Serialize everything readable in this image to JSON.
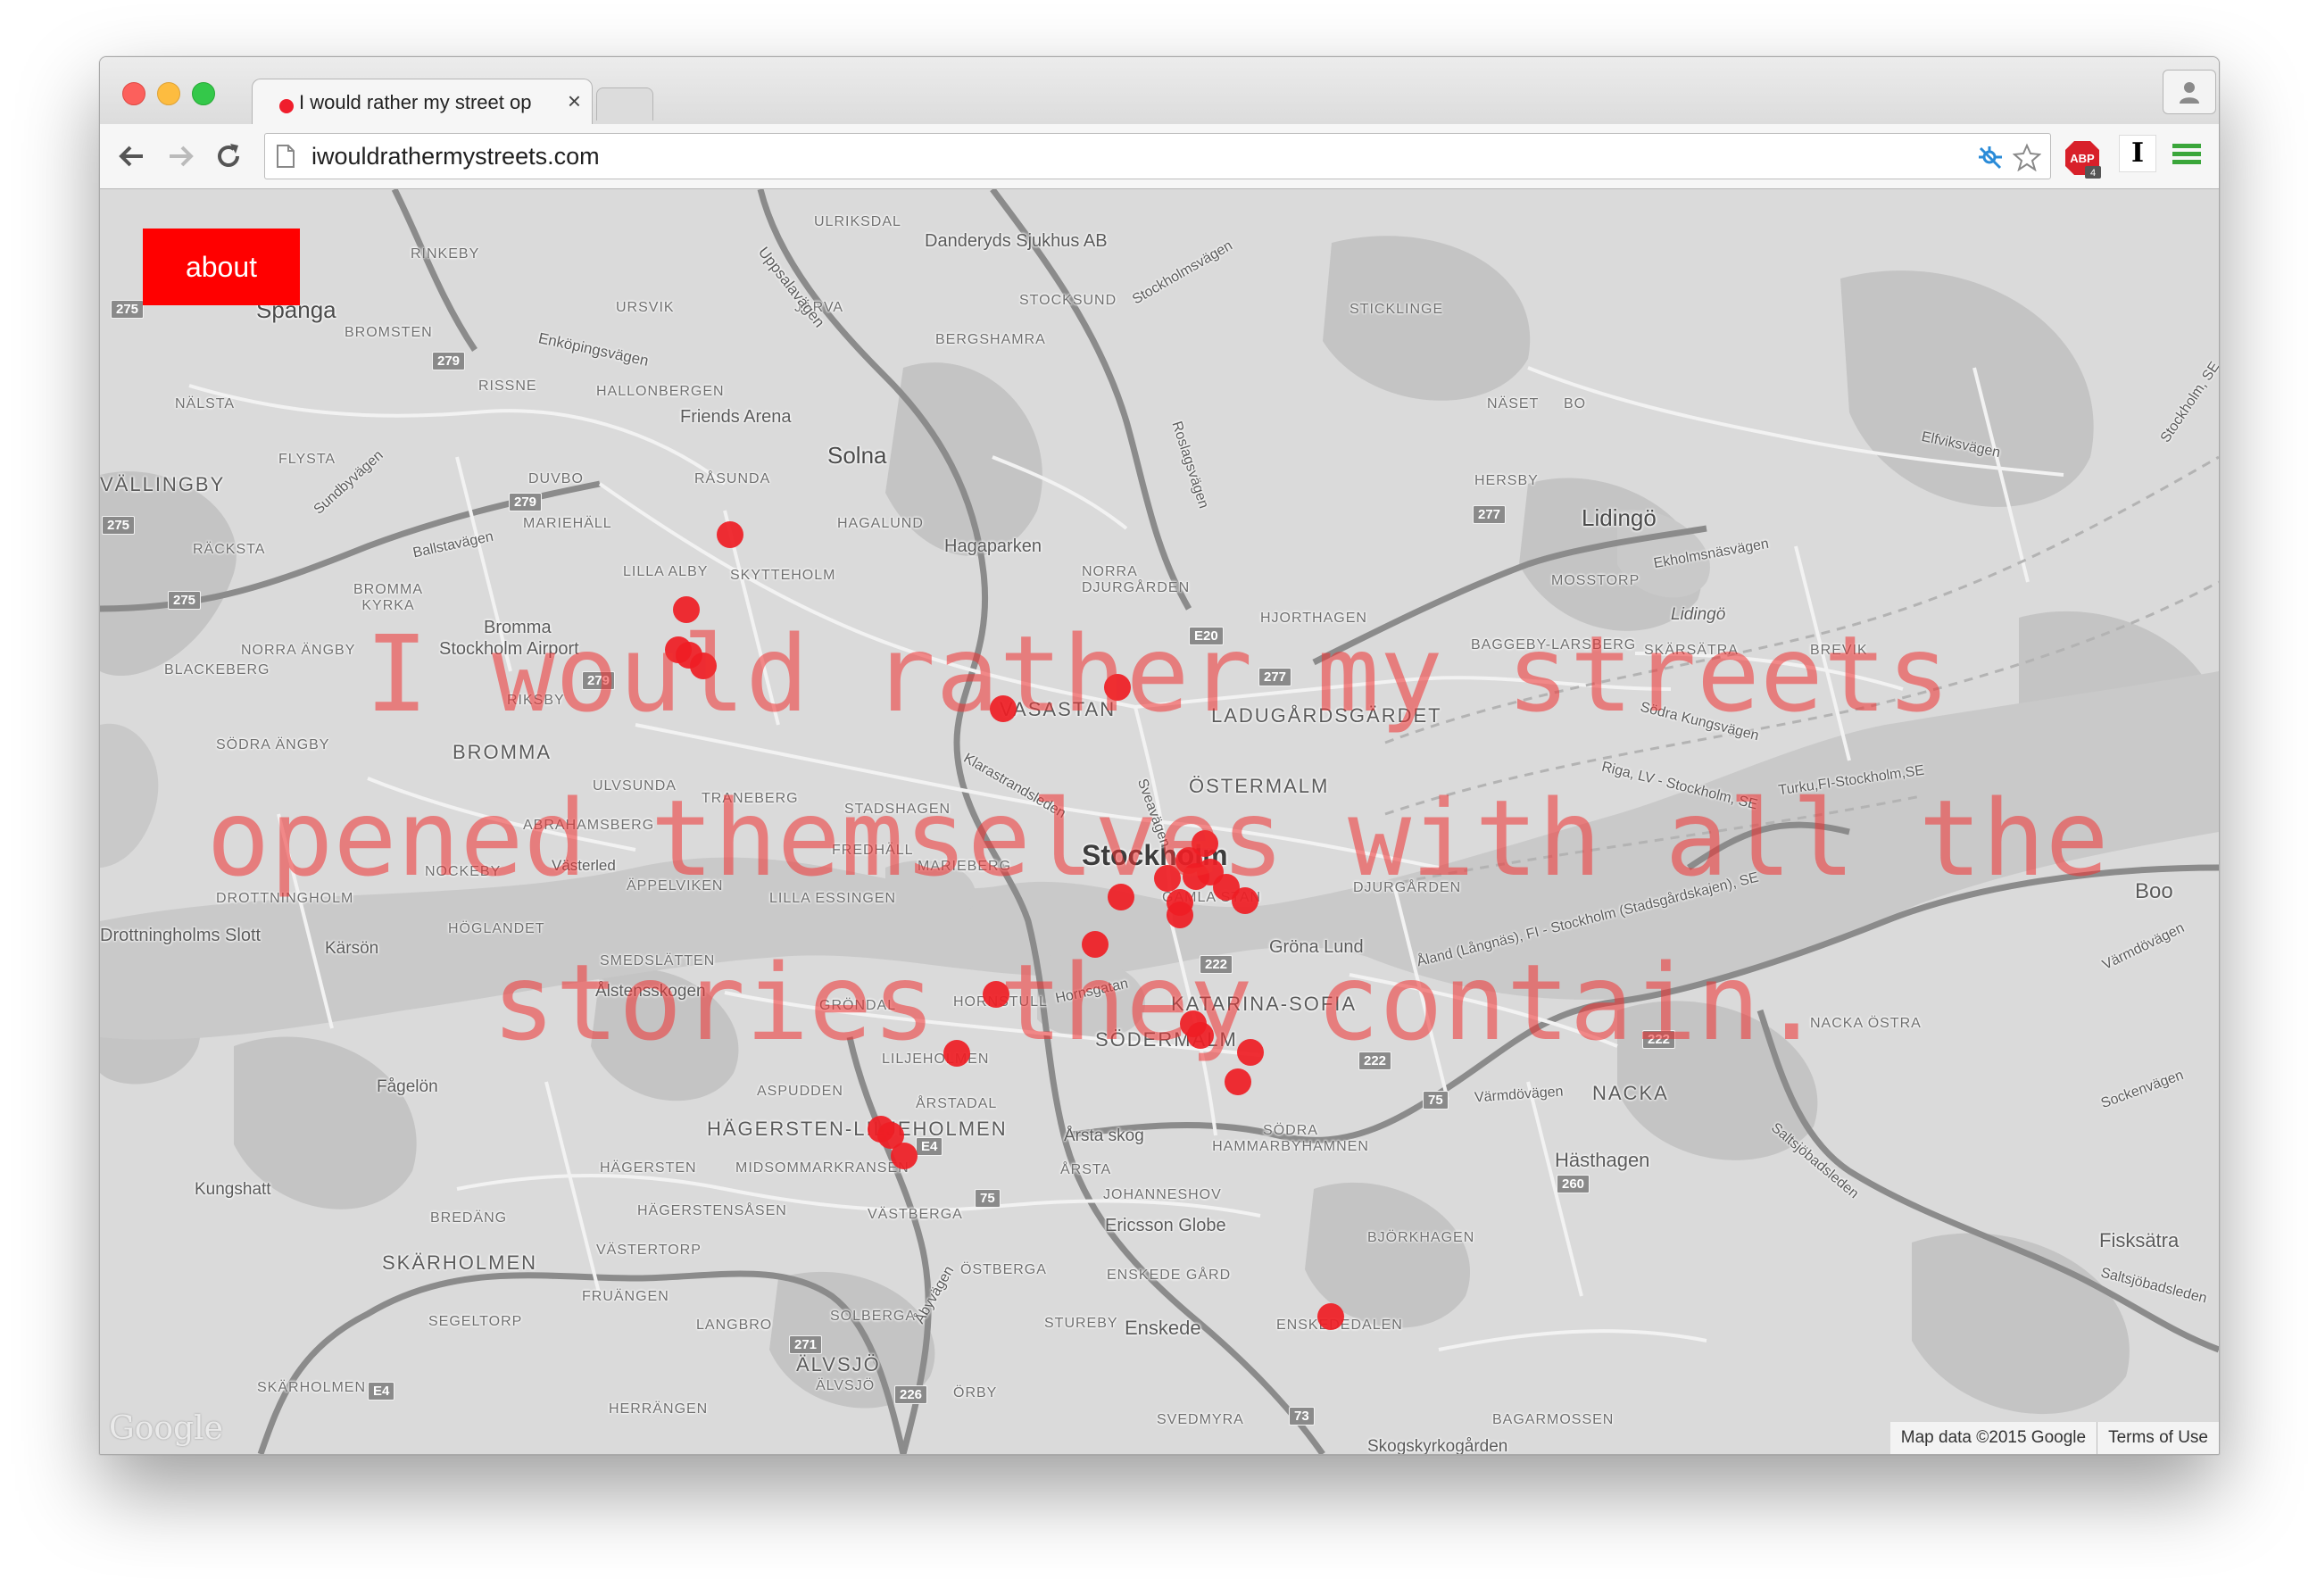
{
  "browser": {
    "tab": {
      "title": "I would rather my street op",
      "close": "×"
    },
    "address_bar": {
      "url": "iwouldrathermystreets.com"
    },
    "extensions": {
      "abp_label": "ABP",
      "abp_badge": "4",
      "instapaper_label": "I"
    }
  },
  "page": {
    "about_button": "about",
    "headline": "I would rather my streets opened themselves with all the stories they contain.",
    "attribution": {
      "map_data": "Map data ©2015 Google",
      "terms": "Terms of Use"
    },
    "map_logo": "Google",
    "marker_color": "#ef1d24",
    "marker_count": 28
  },
  "map_labels": {
    "stockholm": "Stockholm",
    "solna": "Solna",
    "lidingo": "Lidingö",
    "spanga": "Spånga",
    "danderyd": "Danderyds Sjukhus AB",
    "friends_arena": "Friends Arena",
    "hagaparken": "Hagaparken",
    "bromma_airport_1": "Bromma",
    "bromma_airport_2": "Stockholm Airport",
    "bromma": "BROMMA",
    "vasastan": "VASASTAN",
    "ostermalm": "ÖSTERMALM",
    "ladugardsgardet": "LADUGÅRDSGÄRDET",
    "sodermalm": "SÖDERMALM",
    "gamla_stan": "GAMLA STAN",
    "katarina_sofia": "KATARINA-SOFIA",
    "hagersten": "HÄGERSTEN-LILJEHOLMEN",
    "skarholmen": "SKÄRHOLMEN",
    "alvsjo": "ÄLVSJÖ",
    "enskede": "Enskede",
    "ericsson": "Ericsson Globe",
    "nacka": "NACKA",
    "hasthagen": "Hästhagen",
    "fisksatra": "Fisksätra",
    "boo": "Boo",
    "grona_lund": "Gröna Lund",
    "djurgarden": "DJURGÅRDEN",
    "arsta_skog": "Årsta skog",
    "kungshatt": "Kungshatt",
    "fagelon": "Fågelön",
    "alstensskogen": "Ålstensskogen",
    "karson": "Kärsön",
    "drottningholm": "Drottningholms Slott",
    "vallingby": "VÄLLINGBY",
    "nalsta": "NÄLSTA",
    "racksta": "RÄCKSTA",
    "rinkeby": "RINKEBY",
    "bromsten": "BROMSTEN",
    "ursvik": "URSVIK",
    "jarva": "JÄRVA",
    "ulriksdal": "ULRIKSDAL",
    "stocksund": "STOCKSUND",
    "bergshamra": "BERGSHAMRA",
    "sticklinge": "STICKLINGE",
    "naset": "NÄSET",
    "bo": "BO",
    "hersby": "HERSBY",
    "mosstorp": "MOSSTORP",
    "lidingo_small": "Lidingö",
    "hjorthagen": "HJORTHAGEN",
    "norra_djurgarden": "NORRA DJURGÅRDEN",
    "baggeby": "BAGGEBY-LARSBERG",
    "skarsatra": "SKÄRSÄTRA",
    "brevik": "BREVIK",
    "hagalund": "HAGALUND",
    "rasunda": "RÅSUNDA",
    "duvbo": "DUVBO",
    "mariehall": "MARIEHÄLL",
    "lilla_alby": "LILLA ALBY",
    "skytteholm": "SKYTTEHOLM",
    "riksby": "RIKSBY",
    "ulvsunda": "ULVSUNDA",
    "traneberg": "TRANEBERG",
    "stadshagen": "STADSHAGEN",
    "fredhall": "FREDHÄLL",
    "marieberg": "MARIEBERG",
    "lilla_essingen": "LILLA ESSINGEN",
    "abrahamsberg": "ABRAHAMSBERG",
    "nockeby": "NOCKEBY",
    "appelviken": "ÄPPELVIKEN",
    "hoglandet": "HÖGLANDET",
    "smedslatten": "SMEDSLÄTTEN",
    "grondal": "GRÖNDAL",
    "hornstull": "HORNSTULL",
    "liljeholmen": "LILJEHOLMEN",
    "aspudden": "ASPUDDEN",
    "arstadal": "ÅRSTADAL",
    "hagersten_small": "HÄGERSTEN",
    "midsommarkransen": "MIDSOMMARKRANSEN",
    "hagerstensasen": "HÄGERSTENSÅSEN",
    "vastberga": "VÄSTBERGA",
    "vastertorp": "VÄSTERTORP",
    "fruangen": "FRUÄNGEN",
    "segeltorp": "SEGELTORP",
    "langbro": "LANGBRO",
    "solberga": "SOLBERGA",
    "ostberga": "ÖSTBERGA",
    "enskede_gard": "ENSKEDE GÅRD",
    "stureby": "STUREBY",
    "orby": "ÖRBY",
    "svedmyra": "SVEDMYRA",
    "enskededalen": "ENSKEDEDALEN",
    "bagarmossen": "BAGARMOSSEN",
    "bjorkhagen": "BJÖRKHAGEN",
    "johanneshov": "JOHANNESHOV",
    "sodra_hammarbyhamnen": "SÖDRA HAMMARBYHAMNEN",
    "arsta": "ÅRSTA",
    "nacka_ostra": "NACKA ÖSTRA",
    "bredang": "BREDÄNG",
    "herrangen": "HERRÄNGEN",
    "skarholmen_small": "SKÄRHOLMEN",
    "alvsjo_small": "ÄLVSJÖ",
    "sodra_angby": "SÖDRA ÄNGBY",
    "norra_angby": "NORRA ÄNGBY",
    "blackeberg": "BLACKEBERG",
    "brommakyrka": "BROMMA KYRKA",
    "flysta": "FLYSTA",
    "rissne": "RISSNE",
    "hallonbergen": "HALLONBERGEN",
    "drottningholm_small": "DROTTNINGHOLM",
    "vasterled": "Västerled",
    "skogskyrkogarden": "Skogskyrkogården",
    "roads": {
      "uppsalavagen": "Uppsalavägen",
      "enkopingsvagen": "Enköpingsvägen",
      "sundbybergsvagen": "Sundbyvägen",
      "ballstavagen": "Ballstavägen",
      "roslagsvagen": "Roslagsvägen",
      "stockholmsvagen": "Stockholmsvägen",
      "elfviksvagen": "Elfviksvägen",
      "ekholmsnasvagen": "Ekholmsnäsvägen",
      "sodra_kungsvagen": "Södra Kungsvägen",
      "klarastrandsleden": "Klarastrandsleden",
      "sveavagen": "Sveavägen",
      "hornsgatan": "Hornsgatan",
      "varmdovagen": "Värmdövägen",
      "varmdovagen2": "Värmdövägen",
      "sockenvagen": "Sockenvägen",
      "saltsjobadsleden": "Saltsjöbadsleden",
      "saltsjobadsleden2": "Saltsjöbadsleden",
      "abyvagen": "Åbyvägen",
      "riga": "Riga, LV - Stockholm, SE",
      "turku": "Turku,FI-Stockholm,SE",
      "aland": "Åland (Långnäs), FI - Stockholm (Stadsgårdskajen), SE",
      "stockholm_se": "Stockholm, SE"
    },
    "shields": [
      "275",
      "279",
      "279",
      "275",
      "275",
      "279",
      "E20",
      "277",
      "277",
      "222",
      "222",
      "75",
      "75",
      "222",
      "260",
      "E4",
      "E4",
      "271",
      "226",
      "73",
      "E4"
    ]
  }
}
